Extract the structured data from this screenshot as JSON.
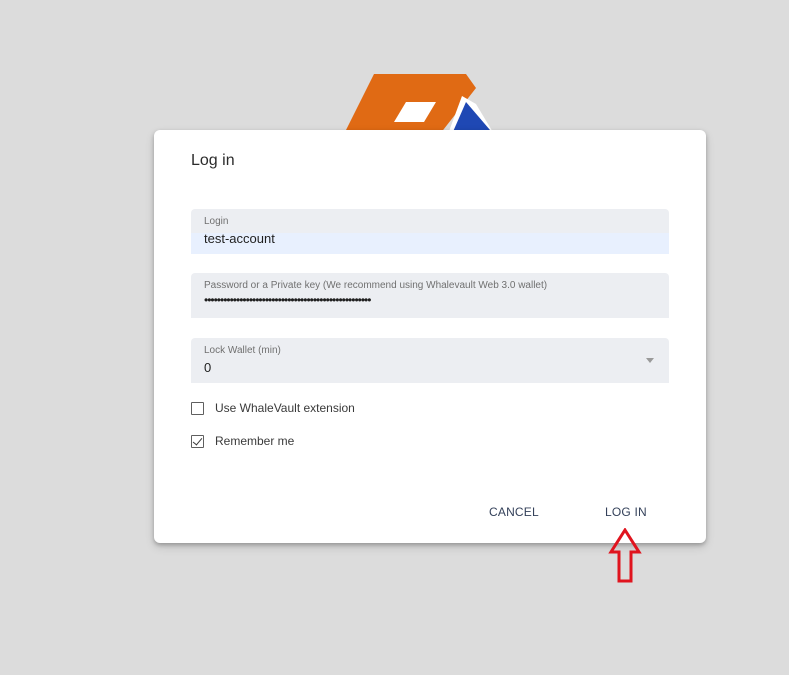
{
  "dialog": {
    "title": "Log in"
  },
  "login_field": {
    "label": "Login",
    "value": "test-account"
  },
  "password_field": {
    "label": "Password or a Private key (We recommend using Whalevault Web 3.0 wallet)",
    "value": "••••••••••••••••••••••••••••••••••••••••••••••••••••"
  },
  "lock_field": {
    "label": "Lock Wallet (min)",
    "value": "0"
  },
  "checkboxes": {
    "whalevault": {
      "label": "Use WhaleVault extension",
      "checked": false
    },
    "remember": {
      "label": "Remember me",
      "checked": true
    }
  },
  "actions": {
    "cancel_label": "CANCEL",
    "login_label": "LOG IN"
  },
  "colors": {
    "logo_orange": "#e06a14",
    "logo_blue": "#1f48b4",
    "annotation_red": "#e0141e",
    "field_bg": "#eceef2",
    "autofill_bg": "#e8f0fe",
    "button_text": "#34415a"
  },
  "icons": {
    "logo": "app-logo",
    "dropdown": "chevron-down-icon",
    "check": "check-icon",
    "annotation": "up-arrow-annotation-icon"
  }
}
